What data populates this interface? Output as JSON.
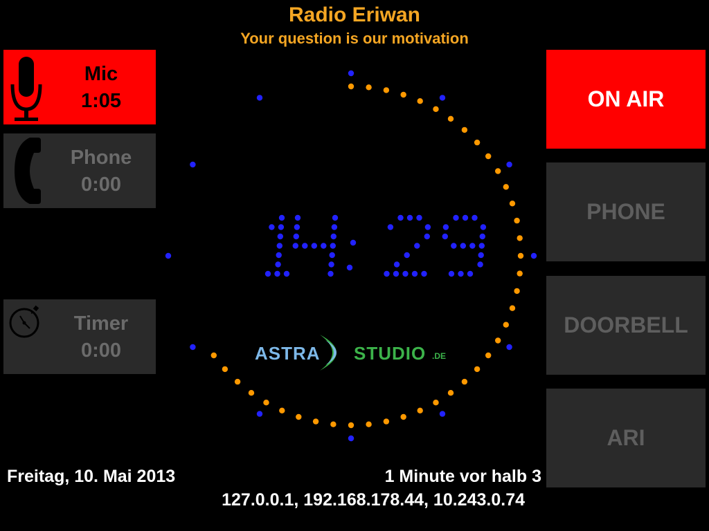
{
  "station": {
    "name": "Radio Eriwan",
    "slogan": "Your question is our motivation"
  },
  "panels": {
    "mic": {
      "label": "Mic",
      "time": "1:05",
      "icon": "microphone-icon",
      "active": true
    },
    "phone": {
      "label": "Phone",
      "time": "0:00",
      "icon": "phone-handset-icon",
      "active": false
    },
    "timer": {
      "label": "Timer",
      "time": "0:00",
      "icon": "stopwatch-icon",
      "active": false
    }
  },
  "buttons": [
    {
      "label": "ON AIR",
      "active": true
    },
    {
      "label": "PHONE",
      "active": false
    },
    {
      "label": "DOORBELL",
      "active": false
    },
    {
      "label": "ARI",
      "active": false
    }
  ],
  "clock": {
    "time": "14:29",
    "hours": "14",
    "minutes": "29",
    "seconds_elapsed": 40,
    "hour_marker_count": 12,
    "colors": {
      "digits": "#2222ff",
      "seconds": "#ff9900",
      "markers": "#2222ff"
    }
  },
  "logo": {
    "left": "ASTRA",
    "right": "STUDIO",
    "suffix": ".DE"
  },
  "footer": {
    "date": "Freitag, 10. Mai 2013",
    "time_words": "1 Minute vor halb 3",
    "ip_addresses": "127.0.0.1, 192.168.178.44, 10.243.0.74"
  },
  "colors": {
    "accent": "#f5a623",
    "active": "#ff0000",
    "inactive_bg": "#2a2a2a",
    "inactive_text": "#5e5e5e"
  }
}
